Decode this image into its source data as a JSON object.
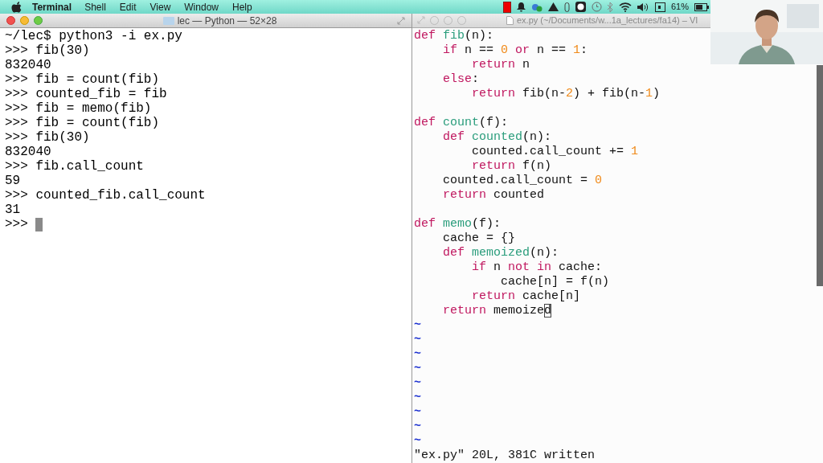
{
  "menu_bar": {
    "app": "Terminal",
    "items": [
      "Shell",
      "Edit",
      "View",
      "Window",
      "Help"
    ],
    "battery": "61%"
  },
  "terminal": {
    "title": "lec — Python — 52×28",
    "lines": [
      "~/lec$ python3 -i ex.py",
      ">>> fib(30)",
      "832040",
      ">>> fib = count(fib)",
      ">>> counted_fib = fib",
      ">>> fib = memo(fib)",
      ">>> fib = count(fib)",
      ">>> fib(30)",
      "832040",
      ">>> fib.call_count",
      "59",
      ">>> counted_fib.call_count",
      "31",
      ">>> "
    ]
  },
  "editor": {
    "title": "ex.py (~/Documents/w...1a_lectures/fa14) – VI",
    "lines": [
      {
        "kind": "code",
        "tokens": [
          {
            "kind": "keyword",
            "text": "def"
          },
          {
            "kind": "function",
            "text": " fib"
          },
          {
            "kind": "plain",
            "text": "(n):"
          }
        ]
      },
      {
        "kind": "code",
        "tokens": [
          {
            "kind": "keyword",
            "text": "    if"
          },
          {
            "kind": "plain",
            "text": " n == "
          },
          {
            "kind": "number",
            "text": "0"
          },
          {
            "kind": "keyword",
            "text": " or"
          },
          {
            "kind": "plain",
            "text": " n == "
          },
          {
            "kind": "number",
            "text": "1"
          },
          {
            "kind": "plain",
            "text": ":"
          }
        ]
      },
      {
        "kind": "code",
        "tokens": [
          {
            "kind": "keyword",
            "text": "        return"
          },
          {
            "kind": "plain",
            "text": " n"
          }
        ]
      },
      {
        "kind": "code",
        "tokens": [
          {
            "kind": "keyword",
            "text": "    else"
          },
          {
            "kind": "plain",
            "text": ":"
          }
        ]
      },
      {
        "kind": "code",
        "tokens": [
          {
            "kind": "keyword",
            "text": "        return"
          },
          {
            "kind": "plain",
            "text": " fib(n-"
          },
          {
            "kind": "number",
            "text": "2"
          },
          {
            "kind": "plain",
            "text": ") + fib(n-"
          },
          {
            "kind": "number",
            "text": "1"
          },
          {
            "kind": "plain",
            "text": ")"
          }
        ]
      },
      {
        "kind": "blank"
      },
      {
        "kind": "code",
        "tokens": [
          {
            "kind": "keyword",
            "text": "def"
          },
          {
            "kind": "function",
            "text": " count"
          },
          {
            "kind": "plain",
            "text": "(f):"
          }
        ]
      },
      {
        "kind": "code",
        "tokens": [
          {
            "kind": "keyword",
            "text": "    def"
          },
          {
            "kind": "function",
            "text": " counted"
          },
          {
            "kind": "plain",
            "text": "(n):"
          }
        ]
      },
      {
        "kind": "code",
        "tokens": [
          {
            "kind": "plain",
            "text": "        counted.call_count += "
          },
          {
            "kind": "number",
            "text": "1"
          }
        ]
      },
      {
        "kind": "code",
        "tokens": [
          {
            "kind": "keyword",
            "text": "        return"
          },
          {
            "kind": "plain",
            "text": " f(n)"
          }
        ]
      },
      {
        "kind": "code",
        "tokens": [
          {
            "kind": "plain",
            "text": "    counted.call_count = "
          },
          {
            "kind": "number",
            "text": "0"
          }
        ]
      },
      {
        "kind": "code",
        "tokens": [
          {
            "kind": "keyword",
            "text": "    return"
          },
          {
            "kind": "plain",
            "text": " counted"
          }
        ]
      },
      {
        "kind": "blank"
      },
      {
        "kind": "code",
        "tokens": [
          {
            "kind": "keyword",
            "text": "def"
          },
          {
            "kind": "function",
            "text": " memo"
          },
          {
            "kind": "plain",
            "text": "(f):"
          }
        ]
      },
      {
        "kind": "code",
        "tokens": [
          {
            "kind": "plain",
            "text": "    cache = {}"
          }
        ]
      },
      {
        "kind": "code",
        "tokens": [
          {
            "kind": "keyword",
            "text": "    def"
          },
          {
            "kind": "function",
            "text": " memoized"
          },
          {
            "kind": "plain",
            "text": "(n):"
          }
        ]
      },
      {
        "kind": "code",
        "tokens": [
          {
            "kind": "keyword",
            "text": "        if"
          },
          {
            "kind": "plain",
            "text": " n"
          },
          {
            "kind": "keyword",
            "text": " not in"
          },
          {
            "kind": "plain",
            "text": " cache:"
          }
        ]
      },
      {
        "kind": "code",
        "tokens": [
          {
            "kind": "plain",
            "text": "            cache[n] = f(n)"
          }
        ]
      },
      {
        "kind": "code",
        "tokens": [
          {
            "kind": "keyword",
            "text": "        return"
          },
          {
            "kind": "plain",
            "text": " cache[n]"
          }
        ]
      },
      {
        "kind": "code",
        "tokens": [
          {
            "kind": "keyword",
            "text": "    return"
          },
          {
            "kind": "plain",
            "text": " memoize"
          },
          {
            "kind": "cursor",
            "text": "d"
          }
        ]
      },
      {
        "kind": "tilde",
        "text": "~"
      },
      {
        "kind": "tilde",
        "text": "~"
      },
      {
        "kind": "tilde",
        "text": "~"
      },
      {
        "kind": "tilde",
        "text": "~"
      },
      {
        "kind": "tilde",
        "text": "~"
      },
      {
        "kind": "tilde",
        "text": "~"
      },
      {
        "kind": "tilde",
        "text": "~"
      },
      {
        "kind": "tilde",
        "text": "~"
      },
      {
        "kind": "tilde",
        "text": "~"
      }
    ],
    "status": "\"ex.py\" 20L, 381C written"
  }
}
